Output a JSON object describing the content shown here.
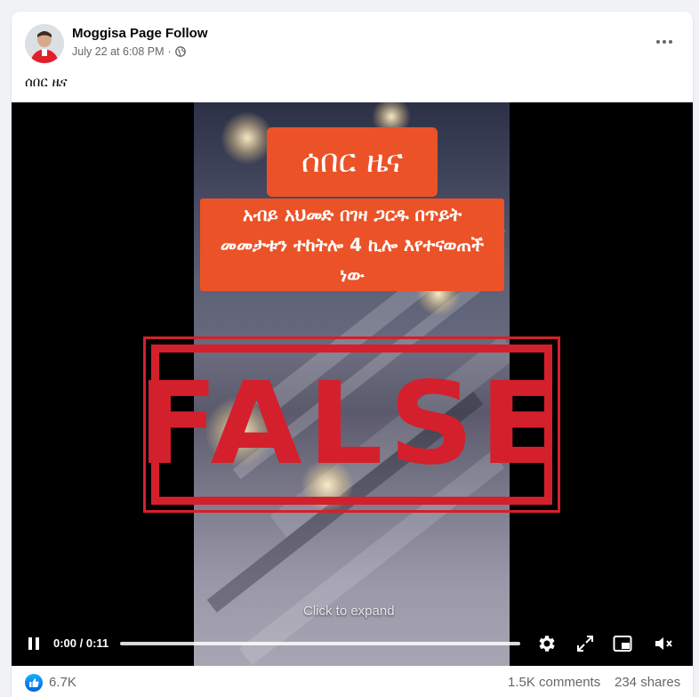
{
  "post": {
    "author": "Moggisa Page Follow",
    "timestamp": "July 22 at 6:08 PM",
    "separator": "·",
    "audience_icon": "globe-icon",
    "more_icon": "more-options-icon",
    "caption": "ሰበር ዜና"
  },
  "video": {
    "banner_title": "ሰበር ዜና",
    "banner_text": "አብይ አህመድ በገዛ ጋርዱ በጥይት መመታቱን ተከትሎ 4 ኪሎ እየተናወጠች ነው",
    "stamp": "FALSE",
    "stamp_color": "#d4202c",
    "banner_color": "#ec5227",
    "expand_hint": "Click to expand",
    "time": "0:00 / 0:11",
    "progress": 0,
    "controls": {
      "play_pause": "pause-icon",
      "settings": "gear-icon",
      "fullscreen": "expand-icon",
      "pip": "picture-in-picture-icon",
      "mute": "muted-speaker-icon"
    }
  },
  "footer": {
    "reactions": "6.7K",
    "reaction_icon": "like-icon",
    "comments": "1.5K comments",
    "shares": "234 shares"
  }
}
